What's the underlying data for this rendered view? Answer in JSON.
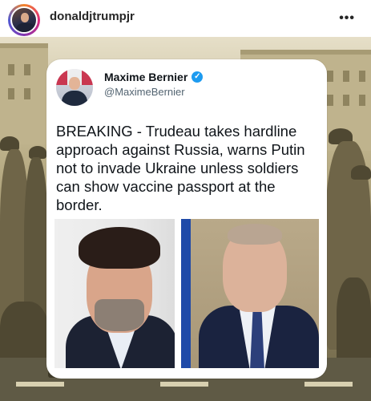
{
  "post": {
    "username": "donaldjtrumpjr",
    "more_label": "•••"
  },
  "tweet": {
    "display_name": "Maxime Bernier",
    "handle": "@MaximeBernier",
    "text": "BREAKING - Trudeau takes hardline approach against Russia, warns Putin not to invade Ukraine unless soldiers can show vaccine passport at the border.",
    "verified_icon": "check-badge-icon"
  },
  "colors": {
    "verified_blue": "#1d9bf0",
    "text_primary": "#0f1419",
    "text_secondary": "#536471"
  }
}
